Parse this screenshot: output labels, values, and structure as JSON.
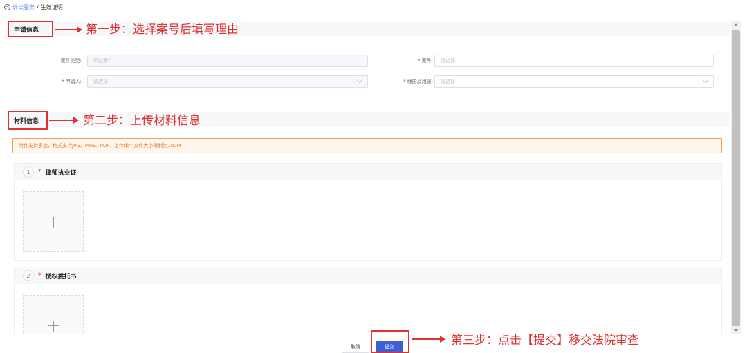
{
  "breadcrumb": {
    "link": "诉讼服务",
    "separator": "/",
    "current": "生效证明"
  },
  "sections": {
    "apply": {
      "title": "申请信息"
    },
    "material": {
      "title": "材料信息"
    }
  },
  "form": {
    "case_type": {
      "label": "案件类型:",
      "placeholder": "诉讼案件"
    },
    "case_no": {
      "label": "案号:",
      "placeholder": "请选择"
    },
    "applicant": {
      "label": "申请人:",
      "placeholder": "请选择"
    },
    "reason": {
      "label": "理由及用途:",
      "placeholder": "请选择"
    }
  },
  "notice": "附件支持多选，格式支持JPG、PNG、PDF，上传单个文件大小限制为100M",
  "uploads": [
    {
      "index": "1",
      "title": "律师执业证"
    },
    {
      "index": "2",
      "title": "授权委托书"
    }
  ],
  "footer": {
    "cancel": "取消",
    "submit": "提交"
  },
  "annotations": {
    "step1": "第一步：选择案号后填写理由",
    "step2": "第二步：上传材料信息",
    "step3": "第三步：点击【提交】移交法院审查"
  },
  "colors": {
    "annotation": "#e03030",
    "primary": "#3e5fd6",
    "notice_border": "#f5a05a",
    "link": "#5b8ff9"
  }
}
